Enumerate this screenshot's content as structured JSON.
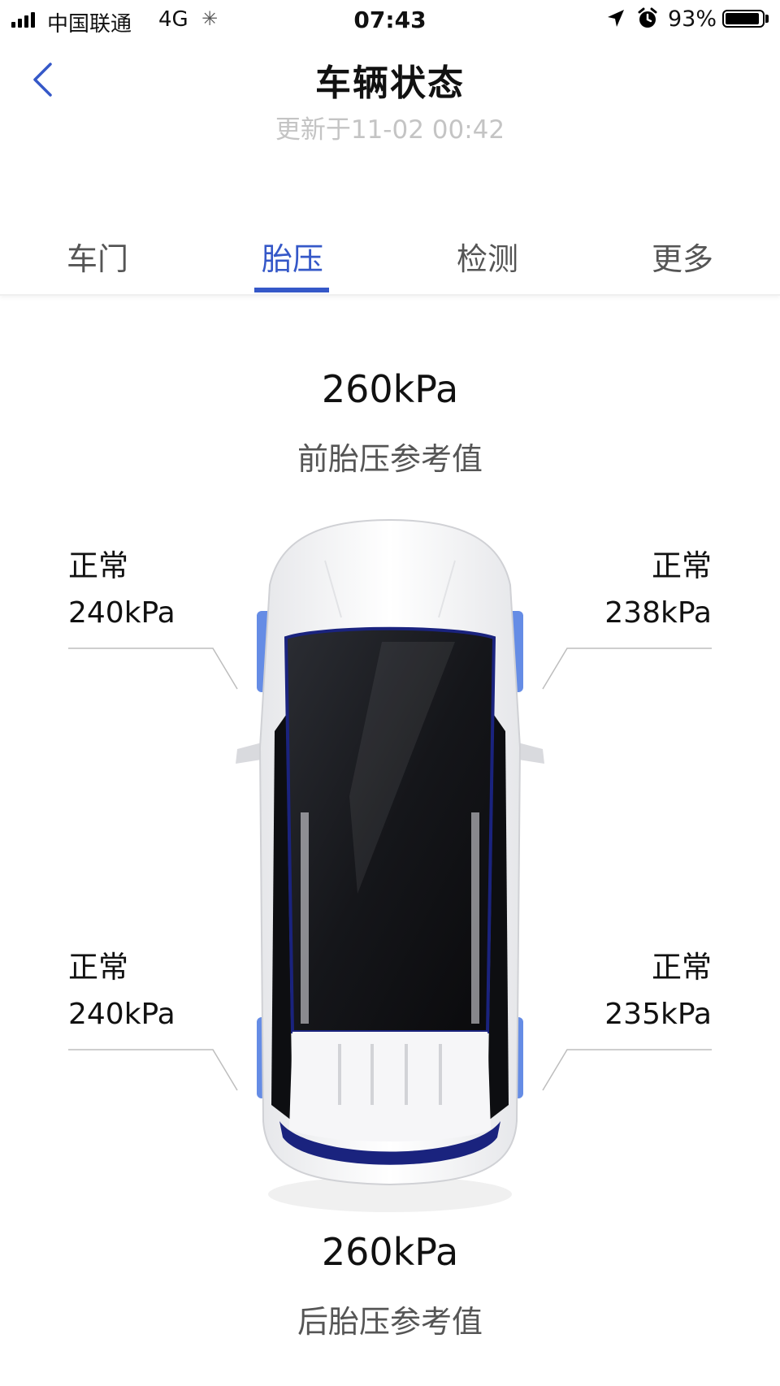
{
  "status_bar": {
    "carrier": "中国联通",
    "network": "4G",
    "time": "07:43",
    "battery": "93%"
  },
  "header": {
    "title": "车辆状态",
    "updated": "更新于11-02 00:42"
  },
  "tabs": [
    {
      "label": "车门",
      "active": false
    },
    {
      "label": "胎压",
      "active": true
    },
    {
      "label": "检测",
      "active": false
    },
    {
      "label": "更多",
      "active": false
    }
  ],
  "front_reference": {
    "value": "260kPa",
    "label": "前胎压参考值"
  },
  "rear_reference": {
    "value": "260kPa",
    "label": "后胎压参考值"
  },
  "tires": {
    "front_left": {
      "status": "正常",
      "pressure": "240kPa"
    },
    "front_right": {
      "status": "正常",
      "pressure": "238kPa"
    },
    "rear_left": {
      "status": "正常",
      "pressure": "240kPa"
    },
    "rear_right": {
      "status": "正常",
      "pressure": "235kPa"
    }
  },
  "colors": {
    "accent": "#3558c8",
    "tire_highlight": "#4a78e0"
  }
}
